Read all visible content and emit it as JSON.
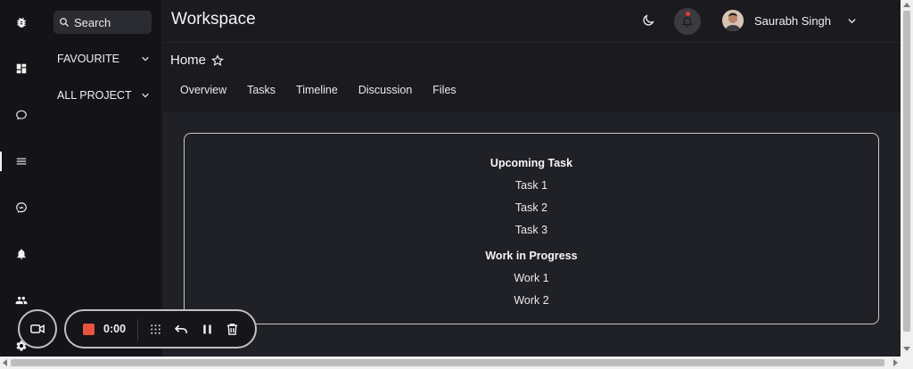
{
  "rail": {
    "items": [
      {
        "name": "bug-icon"
      },
      {
        "name": "dashboard-icon"
      },
      {
        "name": "chat-bubble-icon"
      },
      {
        "name": "menu-icon"
      },
      {
        "name": "messenger-icon"
      },
      {
        "name": "bell-icon"
      },
      {
        "name": "people-icon"
      },
      {
        "name": "settings-icon"
      }
    ]
  },
  "sidebar": {
    "search_placeholder": "Search",
    "sections": [
      {
        "label": "FAVOURITE"
      },
      {
        "label": "ALL PROJECT"
      }
    ]
  },
  "header": {
    "title": "Workspace",
    "user_name": "Saurabh Singh"
  },
  "page": {
    "title": "Home",
    "tabs": [
      {
        "label": "Overview"
      },
      {
        "label": "Tasks"
      },
      {
        "label": "Timeline"
      },
      {
        "label": "Discussion"
      },
      {
        "label": "Files"
      }
    ]
  },
  "card": {
    "upcoming_heading": "Upcoming Task",
    "upcoming_items": [
      "Task 1",
      "Task 2",
      "Task 3"
    ],
    "progress_heading": "Work in Progress",
    "progress_items": [
      "Work 1",
      "Work 2"
    ]
  },
  "recorder": {
    "timer": "0:00"
  },
  "colors": {
    "background": "#1a1a1f",
    "card_border": "#c8c8cc",
    "stop_red": "#e8533f",
    "notification_dot": "#e53935"
  }
}
